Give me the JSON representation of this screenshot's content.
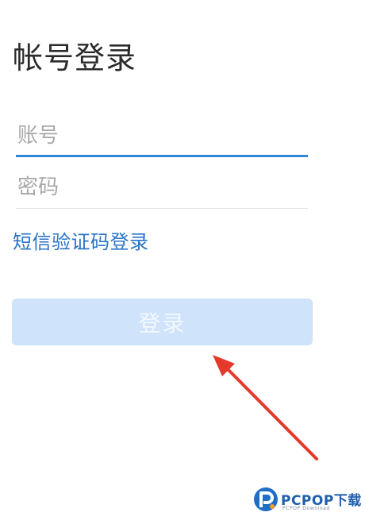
{
  "page": {
    "title": "帐号登录"
  },
  "form": {
    "account_placeholder": "账号",
    "account_value": "",
    "password_placeholder": "密码",
    "password_value": "",
    "sms_login_link": "短信验证码登录",
    "login_button": "登录"
  },
  "annotation": {
    "arrow_color": "#e5392b"
  },
  "watermark": {
    "brand": "PCPOP下载",
    "tagline": "PCPOP Download",
    "icon": "pcpop-logo-icon"
  },
  "colors": {
    "accent": "#2f87d8",
    "link": "#2a73c9",
    "button_disabled": "#cfe3fb"
  }
}
